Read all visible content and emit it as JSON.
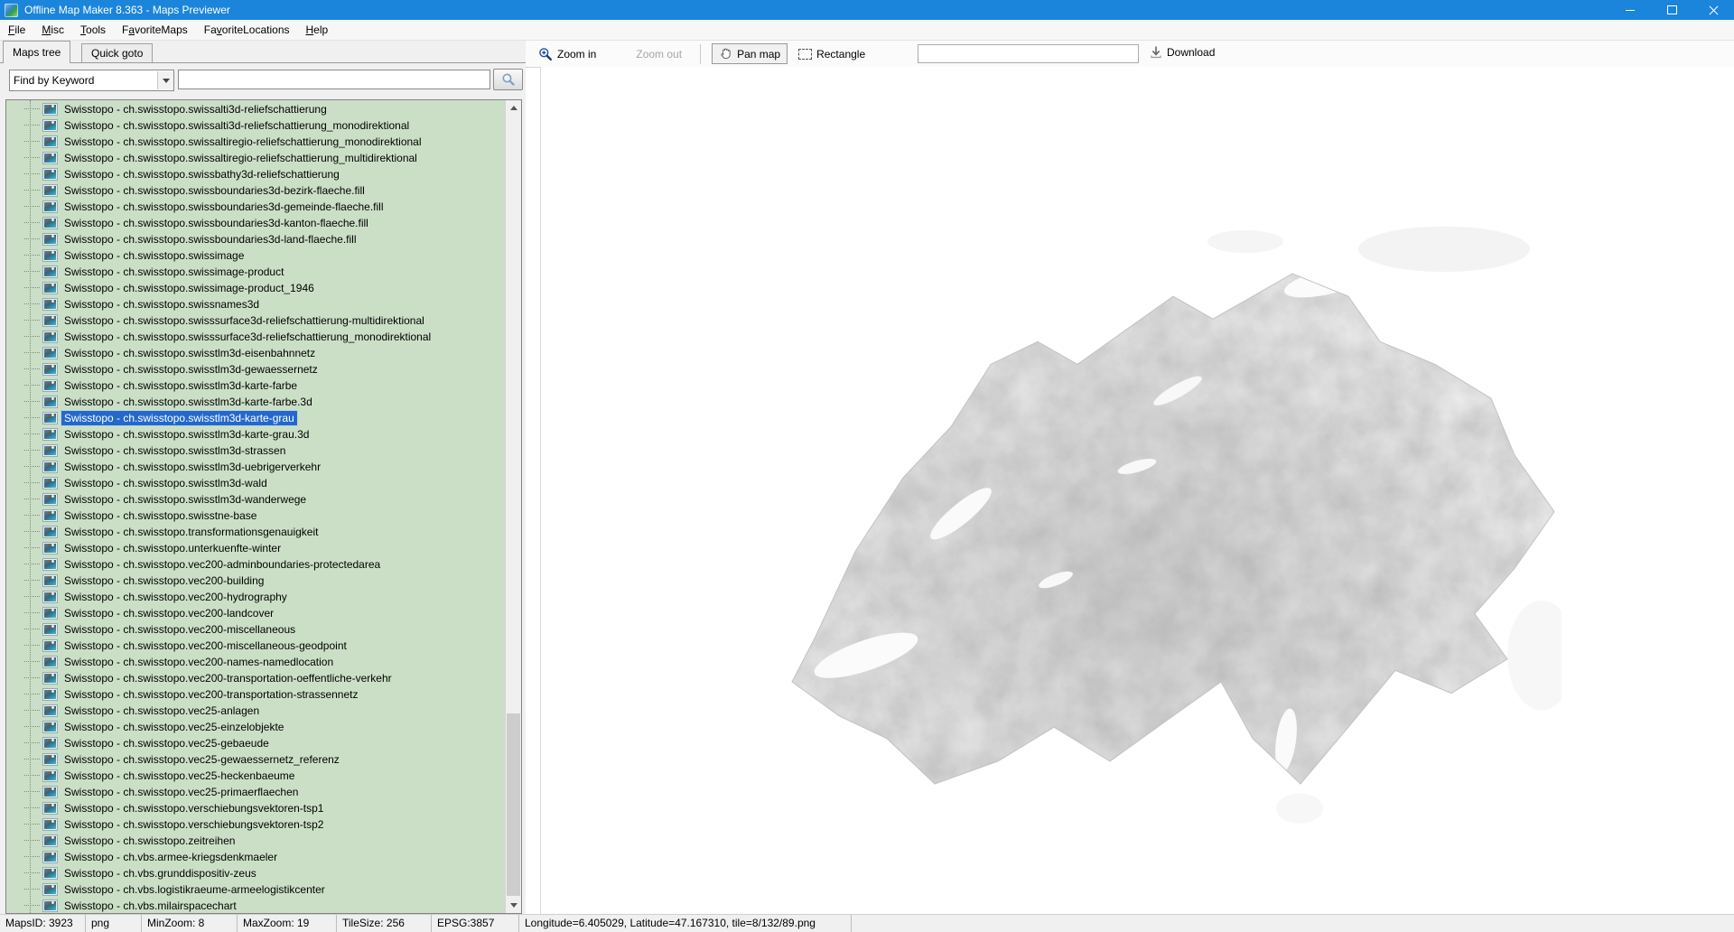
{
  "window": {
    "title": "Offline Map Maker 8.363 - Maps Previewer"
  },
  "colors": {
    "titlebar": "#1b85dc",
    "list_bg": "#cbdfc6",
    "selection": "#2468cb"
  },
  "icons": {
    "app": "map-globe",
    "minimize": "minus-bar",
    "maximize": "square",
    "close": "x-cross",
    "combo": "caret-down",
    "search": "magnifier",
    "zoom_in": "magnifier-plus",
    "pan": "hand",
    "rectangle": "dashed-rect",
    "download": "arrow-down",
    "tree_item": "map-tile-picture"
  },
  "menu": {
    "items": [
      {
        "label": "File",
        "u": 0
      },
      {
        "label": "Misc",
        "u": 0
      },
      {
        "label": "Tools",
        "u": 0
      },
      {
        "label": "FavoriteMaps",
        "u": 1
      },
      {
        "label": "FavoriteLocations",
        "u": 2
      },
      {
        "label": "Help",
        "u": 0
      }
    ]
  },
  "tabs": [
    {
      "label": "Maps tree",
      "active": true
    },
    {
      "label": "Quick goto",
      "active": false
    }
  ],
  "search": {
    "combo_value": "Find by Keyword",
    "input_value": ""
  },
  "toolbar": {
    "zoom_in": "Zoom in",
    "zoom_out": "Zoom out",
    "pan_map": "Pan map",
    "rectangle": "Rectangle",
    "input_value": "",
    "download": "Download"
  },
  "tree": {
    "selected_index": 19,
    "items": [
      "Swisstopo - ch.swisstopo.swissalti3d-reliefschattierung",
      "Swisstopo - ch.swisstopo.swissalti3d-reliefschattierung_monodirektional",
      "Swisstopo - ch.swisstopo.swissaltiregio-reliefschattierung_monodirektional",
      "Swisstopo - ch.swisstopo.swissaltiregio-reliefschattierung_multidirektional",
      "Swisstopo - ch.swisstopo.swissbathy3d-reliefschattierung",
      "Swisstopo - ch.swisstopo.swissboundaries3d-bezirk-flaeche.fill",
      "Swisstopo - ch.swisstopo.swissboundaries3d-gemeinde-flaeche.fill",
      "Swisstopo - ch.swisstopo.swissboundaries3d-kanton-flaeche.fill",
      "Swisstopo - ch.swisstopo.swissboundaries3d-land-flaeche.fill",
      "Swisstopo - ch.swisstopo.swissimage",
      "Swisstopo - ch.swisstopo.swissimage-product",
      "Swisstopo - ch.swisstopo.swissimage-product_1946",
      "Swisstopo - ch.swisstopo.swissnames3d",
      "Swisstopo - ch.swisstopo.swisssurface3d-reliefschattierung-multidirektional",
      "Swisstopo - ch.swisstopo.swisssurface3d-reliefschattierung_monodirektional",
      "Swisstopo - ch.swisstopo.swisstlm3d-eisenbahnnetz",
      "Swisstopo - ch.swisstopo.swisstlm3d-gewaessernetz",
      "Swisstopo - ch.swisstopo.swisstlm3d-karte-farbe",
      "Swisstopo - ch.swisstopo.swisstlm3d-karte-farbe.3d",
      "Swisstopo - ch.swisstopo.swisstlm3d-karte-grau",
      "Swisstopo - ch.swisstopo.swisstlm3d-karte-grau.3d",
      "Swisstopo - ch.swisstopo.swisstlm3d-strassen",
      "Swisstopo - ch.swisstopo.swisstlm3d-uebrigerverkehr",
      "Swisstopo - ch.swisstopo.swisstlm3d-wald",
      "Swisstopo - ch.swisstopo.swisstlm3d-wanderwege",
      "Swisstopo - ch.swisstopo.swisstne-base",
      "Swisstopo - ch.swisstopo.transformationsgenauigkeit",
      "Swisstopo - ch.swisstopo.unterkuenfte-winter",
      "Swisstopo - ch.swisstopo.vec200-adminboundaries-protectedarea",
      "Swisstopo - ch.swisstopo.vec200-building",
      "Swisstopo - ch.swisstopo.vec200-hydrography",
      "Swisstopo - ch.swisstopo.vec200-landcover",
      "Swisstopo - ch.swisstopo.vec200-miscellaneous",
      "Swisstopo - ch.swisstopo.vec200-miscellaneous-geodpoint",
      "Swisstopo - ch.swisstopo.vec200-names-namedlocation",
      "Swisstopo - ch.swisstopo.vec200-transportation-oeffentliche-verkehr",
      "Swisstopo - ch.swisstopo.vec200-transportation-strassennetz",
      "Swisstopo - ch.swisstopo.vec25-anlagen",
      "Swisstopo - ch.swisstopo.vec25-einzelobjekte",
      "Swisstopo - ch.swisstopo.vec25-gebaeude",
      "Swisstopo - ch.swisstopo.vec25-gewaessernetz_referenz",
      "Swisstopo - ch.swisstopo.vec25-heckenbaeume",
      "Swisstopo - ch.swisstopo.vec25-primaerflaechen",
      "Swisstopo - ch.swisstopo.verschiebungsvektoren-tsp1",
      "Swisstopo - ch.swisstopo.verschiebungsvektoren-tsp2",
      "Swisstopo - ch.swisstopo.zeitreihen",
      "Swisstopo - ch.vbs.armee-kriegsdenkmaeler",
      "Swisstopo - ch.vbs.grunddispositiv-zeus",
      "Swisstopo - ch.vbs.logistikraeume-armeelogistikcenter",
      "Swisstopo - ch.vbs.milairspacechart"
    ]
  },
  "statusbar": {
    "maps_id": "MapsID: 3923",
    "format": "png",
    "min_zoom": "MinZoom: 8",
    "max_zoom": "MaxZoom: 19",
    "tile_size": "TileSize: 256",
    "epsg": "EPSG:3857",
    "coords": "Longitude=6.405029, Latitude=47.167310, tile=8/132/89.png"
  }
}
